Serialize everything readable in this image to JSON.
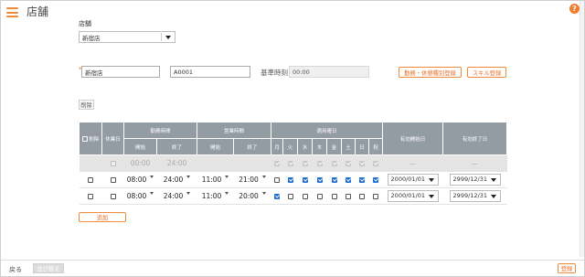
{
  "header": {
    "title": "店舗",
    "help_label": "?"
  },
  "store": {
    "label": "店舗",
    "selected": "新宿店"
  },
  "form": {
    "required_mark": "*",
    "store_name": "新宿店",
    "store_code": "A0001",
    "base_time_label": "基準時刻",
    "base_time_value": "00:00",
    "work_break_button": "勤務・休憩種別登録",
    "skill_button": "スキル登録",
    "delete_button": "削除"
  },
  "table": {
    "headers": {
      "delete": "削除",
      "holiday": "休業日",
      "work_time": "勤務時間",
      "business_time": "営業時間",
      "apply_days": "適用曜日",
      "valid_start": "有効開始日",
      "valid_end": "有効終了日",
      "start": "開始",
      "end": "終了",
      "days": [
        "月",
        "火",
        "水",
        "木",
        "金",
        "土",
        "日",
        "祝"
      ]
    },
    "template_row": {
      "work_start": "00:00",
      "work_end": "24:00",
      "valid_start": "—",
      "valid_end": "—"
    },
    "rows": [
      {
        "work_start": "08:00",
        "work_end": "24:00",
        "biz_start": "11:00",
        "biz_end": "21:00",
        "days": [
          false,
          true,
          true,
          true,
          true,
          true,
          true,
          true
        ],
        "valid_start": "2000/01/01",
        "valid_end": "2999/12/31"
      },
      {
        "work_start": "08:00",
        "work_end": "24:00",
        "biz_start": "11:00",
        "biz_end": "20:00",
        "days": [
          true,
          false,
          false,
          false,
          false,
          false,
          false,
          false
        ],
        "valid_start": "2000/01/01",
        "valid_end": "2999/12/31"
      }
    ]
  },
  "add_button": "追加",
  "footer": {
    "back": "戻る",
    "reorder": "並び替え",
    "register": "登録"
  },
  "colors": {
    "accent": "#ef7e2e",
    "table_header": "#939ba3",
    "checkbox": "#1f6fd1"
  }
}
